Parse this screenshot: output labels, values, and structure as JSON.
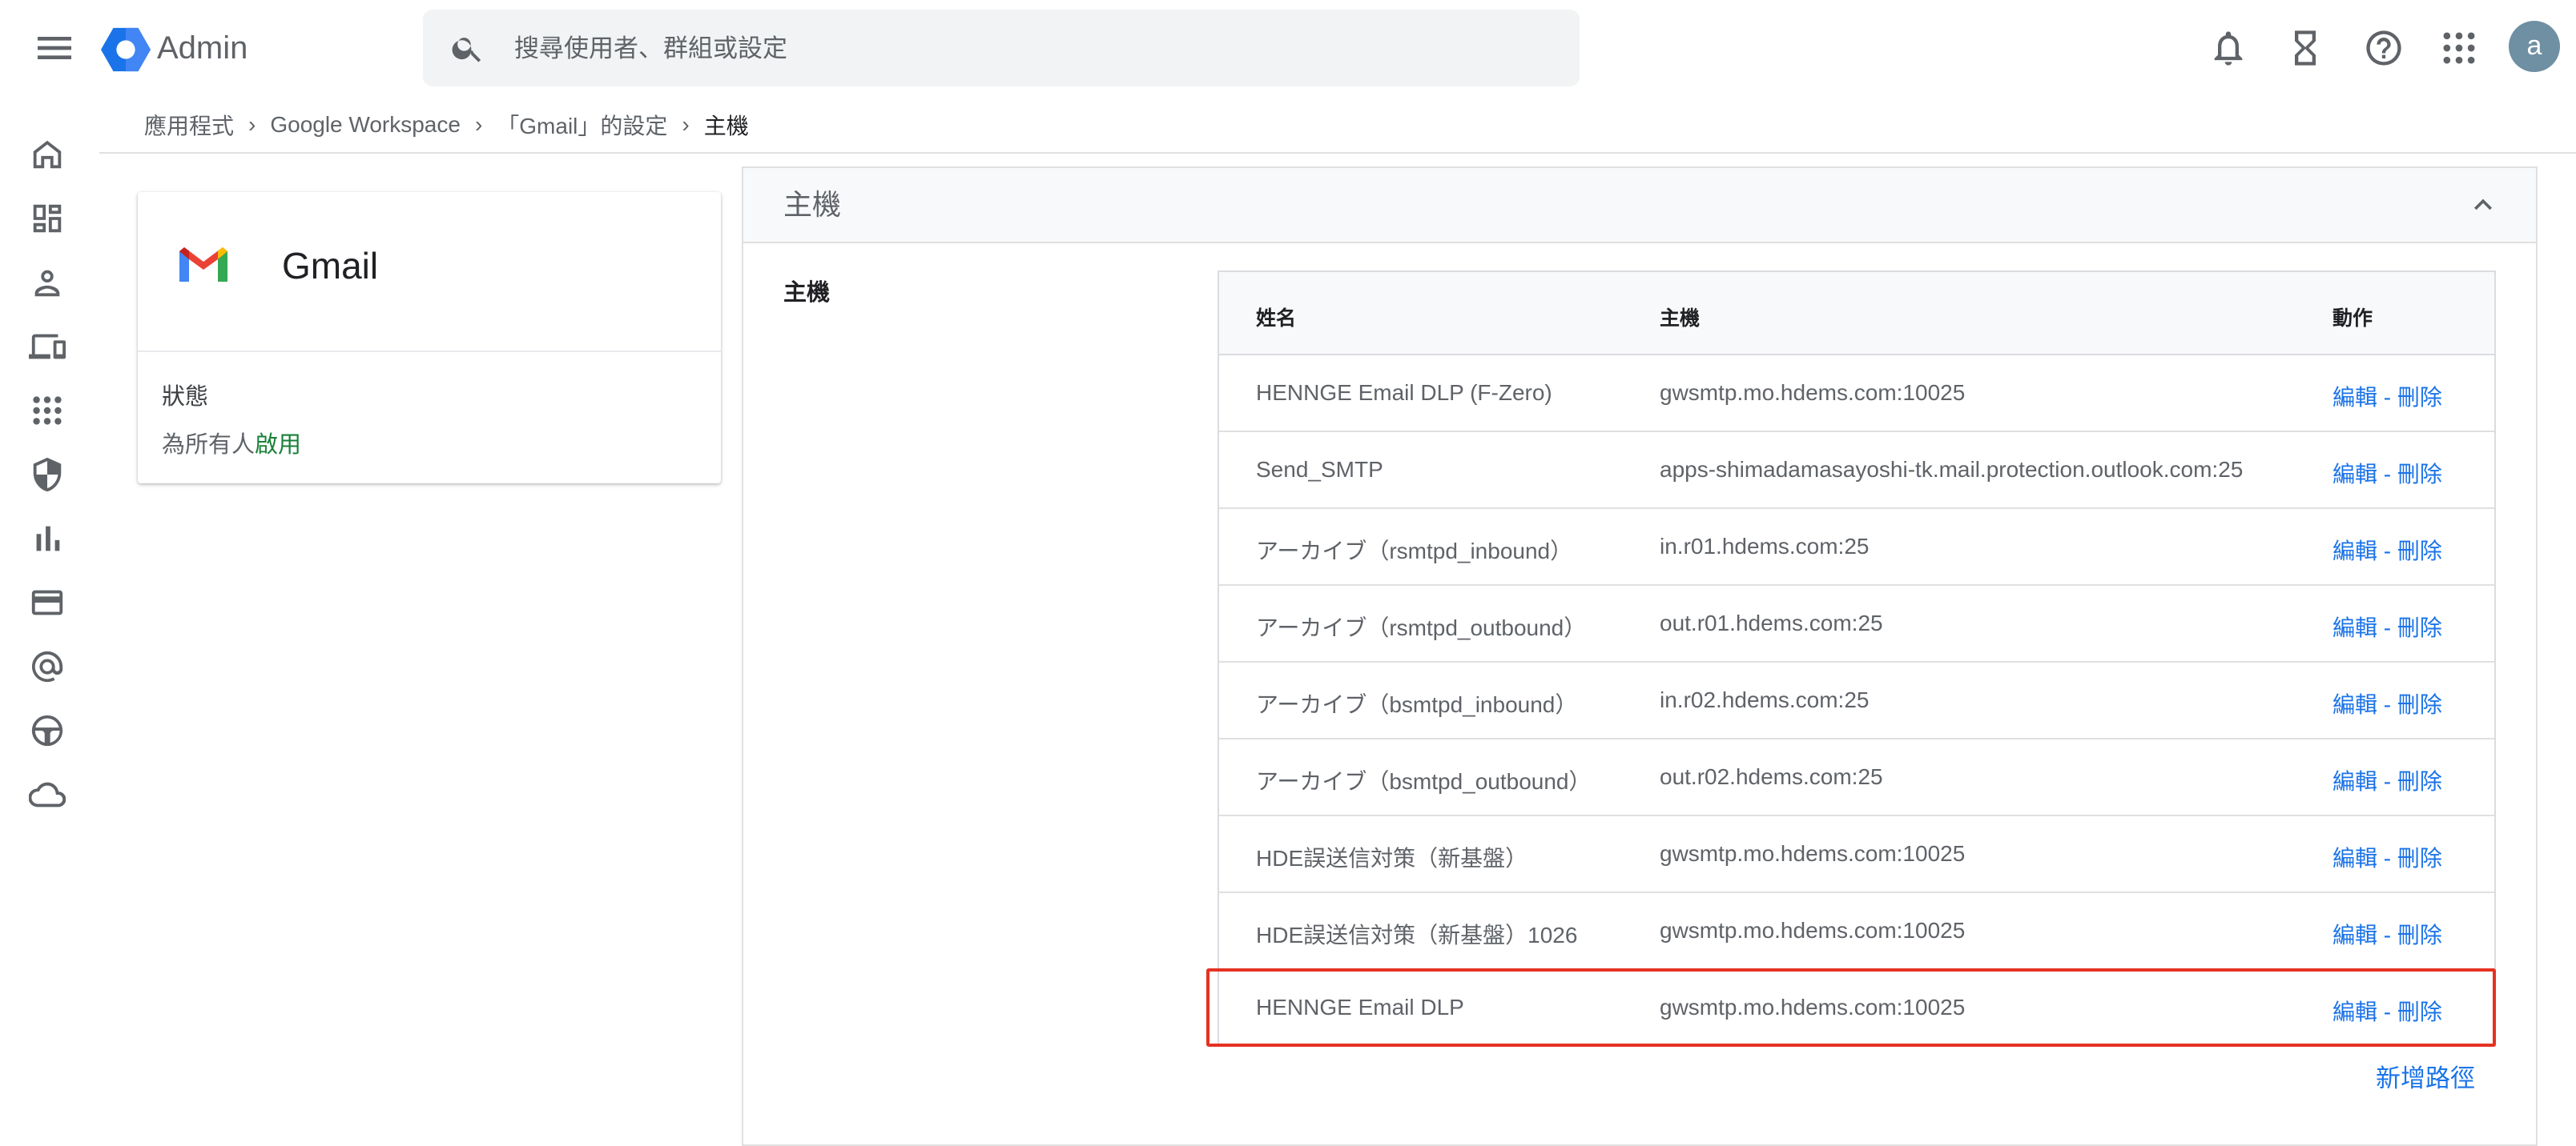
{
  "topbar": {
    "app_name": "Admin",
    "search_placeholder": "搜尋使用者、群組或設定",
    "avatar_letter": "a",
    "icons": [
      "menu-icon",
      "admin-logo",
      "search-icon",
      "bell-icon",
      "hourglass-icon",
      "help-icon",
      "apps-grid-icon"
    ]
  },
  "nav": {
    "icons": [
      "home-icon",
      "dashboard-icon",
      "person-icon",
      "devices-icon",
      "apps-icon",
      "shield-icon",
      "bar-chart-icon",
      "billing-card-icon",
      "at-sign-icon",
      "steering-wheel-icon",
      "cloud-icon"
    ]
  },
  "breadcrumb": {
    "items": [
      "應用程式",
      "Google Workspace",
      "「Gmail」的設定"
    ],
    "current": "主機"
  },
  "app_card": {
    "title": "Gmail",
    "status_label": "狀態",
    "status_prefix": "為所有人",
    "status_value": "啟用"
  },
  "panel": {
    "title": "主機",
    "section_label": "主機",
    "add_route": "新增路徑"
  },
  "table": {
    "headers": {
      "name": "姓名",
      "host": "主機",
      "action": "動作"
    },
    "edit_label": "編輯",
    "separator": " - ",
    "delete_label": "刪除",
    "rows": [
      {
        "name": "HENNGE Email DLP (F-Zero)",
        "host": "gwsmtp.mo.hdems.com:10025"
      },
      {
        "name": "Send_SMTP",
        "host": "apps-shimadamasayoshi-tk.mail.protection.outlook.com:25"
      },
      {
        "name": "アーカイブ（rsmtpd_inbound）",
        "host": "in.r01.hdems.com:25"
      },
      {
        "name": "アーカイブ（rsmtpd_outbound）",
        "host": "out.r01.hdems.com:25"
      },
      {
        "name": "アーカイブ（bsmtpd_inbound）",
        "host": "in.r02.hdems.com:25"
      },
      {
        "name": "アーカイブ（bsmtpd_outbound）",
        "host": "out.r02.hdems.com:25"
      },
      {
        "name": "HDE誤送信対策（新基盤）",
        "host": "gwsmtp.mo.hdems.com:10025"
      },
      {
        "name": "HDE誤送信対策（新基盤）1026",
        "host": "gwsmtp.mo.hdems.com:10025"
      },
      {
        "name": "HENNGE Email DLP",
        "host": "gwsmtp.mo.hdems.com:10025"
      }
    ],
    "highlighted_row": "HENNGE Email DLP"
  },
  "colors": {
    "link": "#1a73e8",
    "enabled": "#188038",
    "highlight_border": "#e53222",
    "avatar": "#6f8fa3"
  }
}
